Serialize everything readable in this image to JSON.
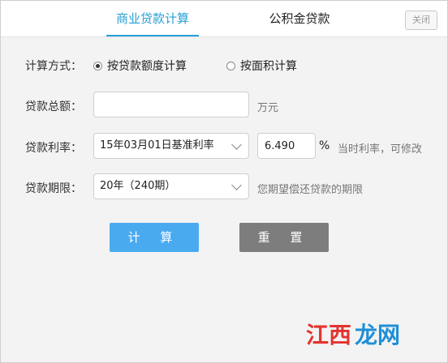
{
  "tabs": [
    {
      "label": "商业贷款计算",
      "active": true
    },
    {
      "label": "公积金贷款",
      "active": false
    }
  ],
  "close_label": "关闭",
  "calc_mode": {
    "label": "计算方式：",
    "options": [
      {
        "label": "按贷款额度计算",
        "checked": true
      },
      {
        "label": "按面积计算",
        "checked": false
      }
    ]
  },
  "amount": {
    "label": "贷款总额：",
    "value": "",
    "unit": "万元"
  },
  "rate": {
    "label": "贷款利率：",
    "selected": "15年03月01日基准利率",
    "value": "6.490",
    "unit": "%",
    "hint": "当时利率，可修改"
  },
  "term": {
    "label": "贷款期限：",
    "selected": "20年（240期）",
    "hint": "您期望偿还贷款的期限"
  },
  "buttons": {
    "calculate": "计 算",
    "reset": "重 置"
  },
  "watermark": {
    "text": "江西龙网",
    "colors": {
      "red": "#e3342f",
      "blue": "#1f8fd6"
    }
  }
}
